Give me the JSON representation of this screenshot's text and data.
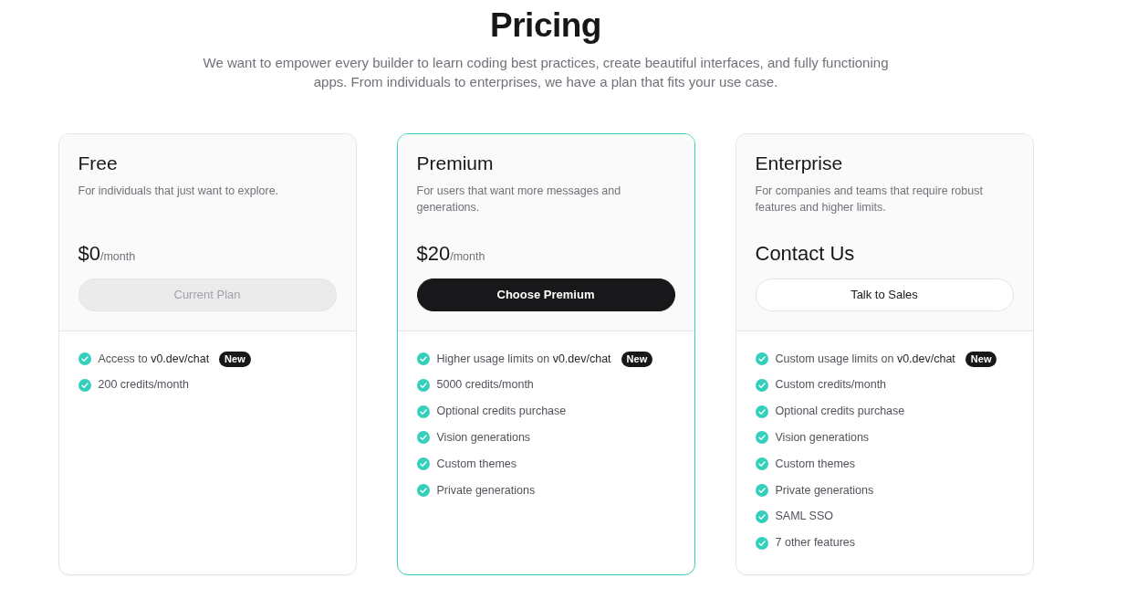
{
  "header": {
    "title": "Pricing",
    "subtitle": "We want to empower every builder to learn coding best practices, create beautiful interfaces, and fully functioning apps. From individuals to enterprises, we have a plan that fits your use case."
  },
  "plans": [
    {
      "name": "Free",
      "description": "For individuals that just want to explore.",
      "highlighted": false,
      "price": {
        "amount": "$0",
        "period": "/month"
      },
      "button": {
        "label": "Current Plan",
        "kind": "disabled"
      },
      "features": [
        {
          "text": "Access to **v0.dev/chat**",
          "badge": "New"
        },
        {
          "text": "200 credits/month"
        }
      ]
    },
    {
      "name": "Premium",
      "description": "For users that want more messages and generations.",
      "highlighted": true,
      "price": {
        "amount": "$20",
        "period": "/month"
      },
      "button": {
        "label": "Choose Premium",
        "kind": "primary"
      },
      "features": [
        {
          "text": "Higher usage limits on **v0.dev/chat**",
          "badge": "New"
        },
        {
          "text": "5000 credits/month"
        },
        {
          "text": "Optional credits purchase"
        },
        {
          "text": "Vision generations"
        },
        {
          "text": "Custom themes"
        },
        {
          "text": "Private generations"
        }
      ]
    },
    {
      "name": "Enterprise",
      "description": "For companies and teams that require robust features and higher limits.",
      "highlighted": false,
      "price": {
        "amount": "Contact Us"
      },
      "button": {
        "label": "Talk to Sales",
        "kind": "outline"
      },
      "features": [
        {
          "text": "Custom usage limits on **v0.dev/chat**",
          "badge": "New"
        },
        {
          "text": "Custom credits/month"
        },
        {
          "text": "Optional credits purchase"
        },
        {
          "text": "Vision generations"
        },
        {
          "text": "Custom themes"
        },
        {
          "text": "Private generations"
        },
        {
          "text": "SAML SSO"
        },
        {
          "text": "7 other features"
        }
      ]
    }
  ]
}
